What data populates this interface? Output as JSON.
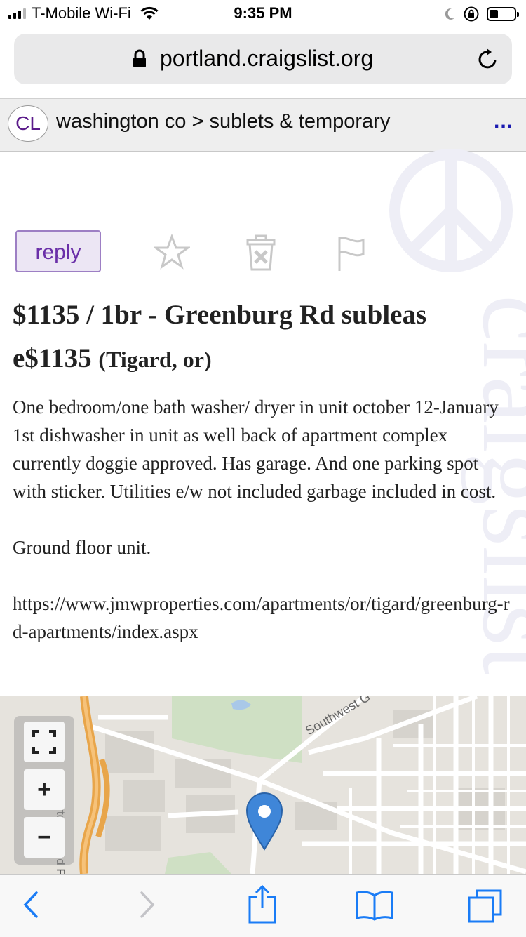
{
  "status_bar": {
    "carrier": "T-Mobile Wi-Fi",
    "time": "9:35 PM",
    "battery_level": 0.35,
    "signal_bars": 3
  },
  "browser": {
    "url": "portland.craigslist.org"
  },
  "breadcrumb": {
    "logo": "CL",
    "path": "washington co > sublets & temporary",
    "more": "..."
  },
  "actions": {
    "reply_label": "reply",
    "icons": [
      "star-icon",
      "hide-trash-icon",
      "flag-icon"
    ]
  },
  "posting": {
    "title_main": "$1135 / 1br - Greenburg Rd subleas​e$1135",
    "title_location": "(Tigard, or)",
    "body_paragraph_1": "One bedroom/one bath washer/ dryer in unit october 12-January 1st dishwasher in unit as well back of apartment complex currently doggie approved. Has garage. And one parking spot with sticker. Utilities e/w not included garbage included in cost.",
    "body_paragraph_2": "Ground floor unit.",
    "body_link": "https://www.jmwproperties.com/apartments/or/tigard/greenburg-rd-apartments/index.aspx"
  },
  "map": {
    "road_label_1": "Beaverton-Tigard Freew",
    "road_label_2": "Southwest G",
    "zoom_in": "+",
    "zoom_out": "−"
  },
  "colors": {
    "accent_purple": "#6a2fa8",
    "link_blue": "#1a7cf6",
    "map_pin": "#3f86d8",
    "freeway_orange": "#e8a54a"
  }
}
